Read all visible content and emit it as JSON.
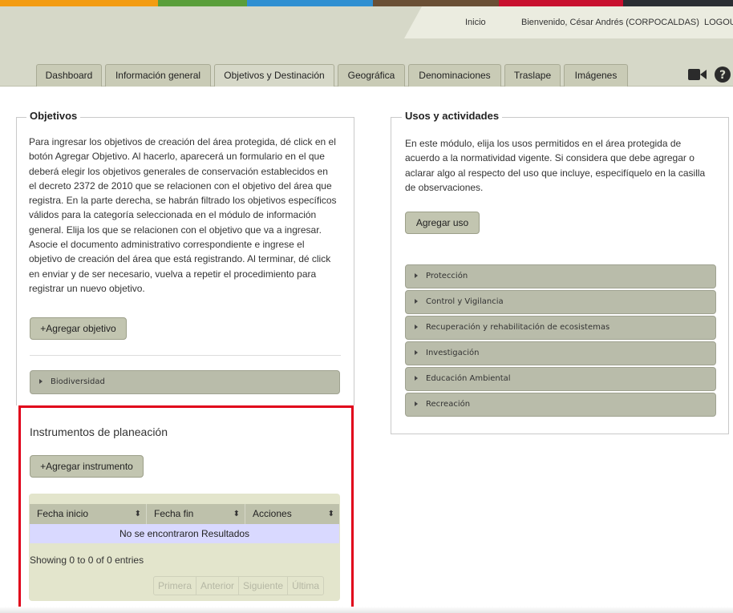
{
  "colors": {
    "strip": [
      "#f39c12",
      "#5a9e3a",
      "#2f8fd1",
      "#6a4f35",
      "#c8102e",
      "#2b2e33"
    ],
    "highlight": "#e0001a"
  },
  "header": {
    "nav_home": "Inicio",
    "welcome": "Bienvenido, César Andrés (CORPOCALDAS)",
    "logout": "LOGOU"
  },
  "tabs": [
    {
      "label": "Dashboard"
    },
    {
      "label": "Información general"
    },
    {
      "label": "Objetivos y Destinación",
      "active": true
    },
    {
      "label": "Geográfica"
    },
    {
      "label": "Denominaciones"
    },
    {
      "label": "Traslape"
    },
    {
      "label": "Imágenes"
    }
  ],
  "toolbar_icons": [
    "video-camera-icon",
    "help-icon"
  ],
  "objetivos": {
    "legend": "Objetivos",
    "lines": [
      "Para ingresar los objetivos de creación del área protegida, dé click en el",
      "botón Agregar Objetivo. Al hacerlo, aparecerá un formulario en el que",
      "deberá elegir los objetivos generales de conservación establecidos en",
      "el decreto 2372 de 2010 que se relacionen con el objetivo del área que",
      "registra. En la parte derecha, se habrán filtrado los objetivos específicos",
      "válidos para la categoría seleccionada en el módulo de información",
      "general. Elija los que se relacionen con el objetivo que va a ingresar.",
      "Asocie el documento administrativo correspondiente e ingrese el",
      "objetivo de creación del área que está registrando. Al terminar, dé click",
      "en enviar y de ser necesario, vuelva a repetir el procedimiento para",
      "registrar un nuevo objetivo."
    ],
    "add_button": "+Agregar objetivo",
    "accordion": [
      "Biodiversidad"
    ]
  },
  "instrumentos": {
    "title": "Instrumentos de planeación",
    "add_button": "+Agregar instrumento",
    "columns": [
      "Fecha inicio",
      "Fecha fin",
      "Acciones"
    ],
    "sort_glyph": "⬍",
    "empty": "No se encontraron Resultados",
    "info": "Showing 0 to 0 of 0 entries",
    "pager": [
      "Primera",
      "Anterior",
      "Siguiente",
      "Última"
    ]
  },
  "usos": {
    "legend": "Usos y actividades",
    "lines": [
      "En este módulo, elija los usos permitidos en el área protegida de",
      "acuerdo a la normatividad vigente. Si considera que debe agregar o",
      "aclarar algo al respecto del uso que incluye, especifíquelo en la casilla",
      "de observaciones."
    ],
    "add_button": "Agregar uso",
    "accordion": [
      "Protección",
      "Control y Vigilancia",
      "Recuperación y rehabilitación de ecosistemas",
      "Investigación",
      "Educación Ambiental",
      "Recreación"
    ]
  }
}
